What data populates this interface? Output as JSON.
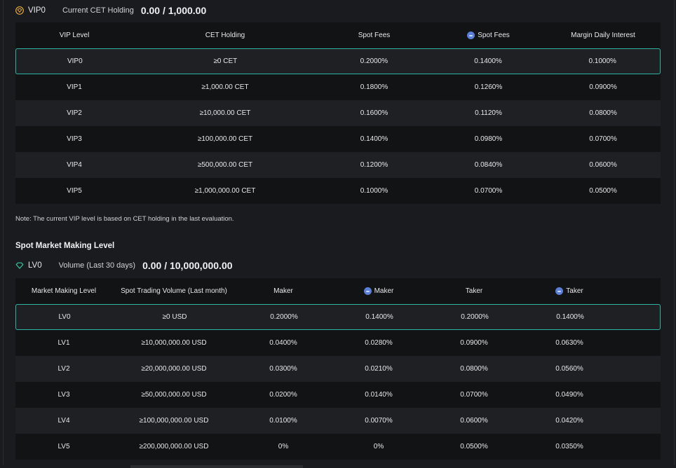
{
  "vip": {
    "level": "VIP0",
    "holding_label": "Current CET Holding",
    "holding_value": "0.00 / 1,000.00",
    "headers": [
      "VIP Level",
      "CET Holding",
      "Spot Fees",
      "Spot Fees",
      "Margin Daily Interest"
    ],
    "rows": [
      [
        "VIP0",
        "≥0 CET",
        "0.2000%",
        "0.1400%",
        "0.1000%"
      ],
      [
        "VIP1",
        "≥1,000.00 CET",
        "0.1800%",
        "0.1260%",
        "0.0900%"
      ],
      [
        "VIP2",
        "≥10,000.00 CET",
        "0.1600%",
        "0.1120%",
        "0.0800%"
      ],
      [
        "VIP3",
        "≥100,000.00 CET",
        "0.1400%",
        "0.0980%",
        "0.0700%"
      ],
      [
        "VIP4",
        "≥500,000.00 CET",
        "0.1200%",
        "0.0840%",
        "0.0600%"
      ],
      [
        "VIP5",
        "≥1,000,000.00 CET",
        "0.1000%",
        "0.0700%",
        "0.0500%"
      ]
    ]
  },
  "note": "Note: The current VIP level is based on CET holding in the last evaluation.",
  "mm": {
    "section_title": "Spot Market Making Level",
    "level": "LV0",
    "volume_label": "Volume (Last 30 days)",
    "volume_value": "0.00 / 10,000,000.00",
    "headers": [
      "Market Making Level",
      "Spot Trading Volume (Last month)",
      "Maker",
      "Maker",
      "Taker",
      "Taker"
    ],
    "rows": [
      [
        "LV0",
        "≥0 USD",
        "0.2000%",
        "0.1400%",
        "0.2000%",
        "0.1400%"
      ],
      [
        "LV1",
        "≥10,000,000.00 USD",
        "0.0400%",
        "0.0280%",
        "0.0900%",
        "0.0630%"
      ],
      [
        "LV2",
        "≥20,000,000.00 USD",
        "0.0300%",
        "0.0210%",
        "0.0800%",
        "0.0560%"
      ],
      [
        "LV3",
        "≥50,000,000.00 USD",
        "0.0200%",
        "0.0140%",
        "0.0700%",
        "0.0490%"
      ],
      [
        "LV4",
        "≥100,000,000.00 USD",
        "0.0100%",
        "0.0070%",
        "0.0600%",
        "0.0420%"
      ],
      [
        "LV5",
        "≥200,000,000.00 USD",
        "0%",
        "0%",
        "0.0500%",
        "0.0350%"
      ]
    ]
  },
  "colors": {
    "accent_teal": "#2fb3a5",
    "vip_badge": "#e8a93a",
    "lv_badge": "#2fc7a0",
    "cet_coin": "#5b7fd6"
  },
  "icons": {
    "vip_badge": "diamond-badge-icon",
    "lv_badge": "diamond-outline-icon",
    "cet": "cet-coin-icon"
  }
}
